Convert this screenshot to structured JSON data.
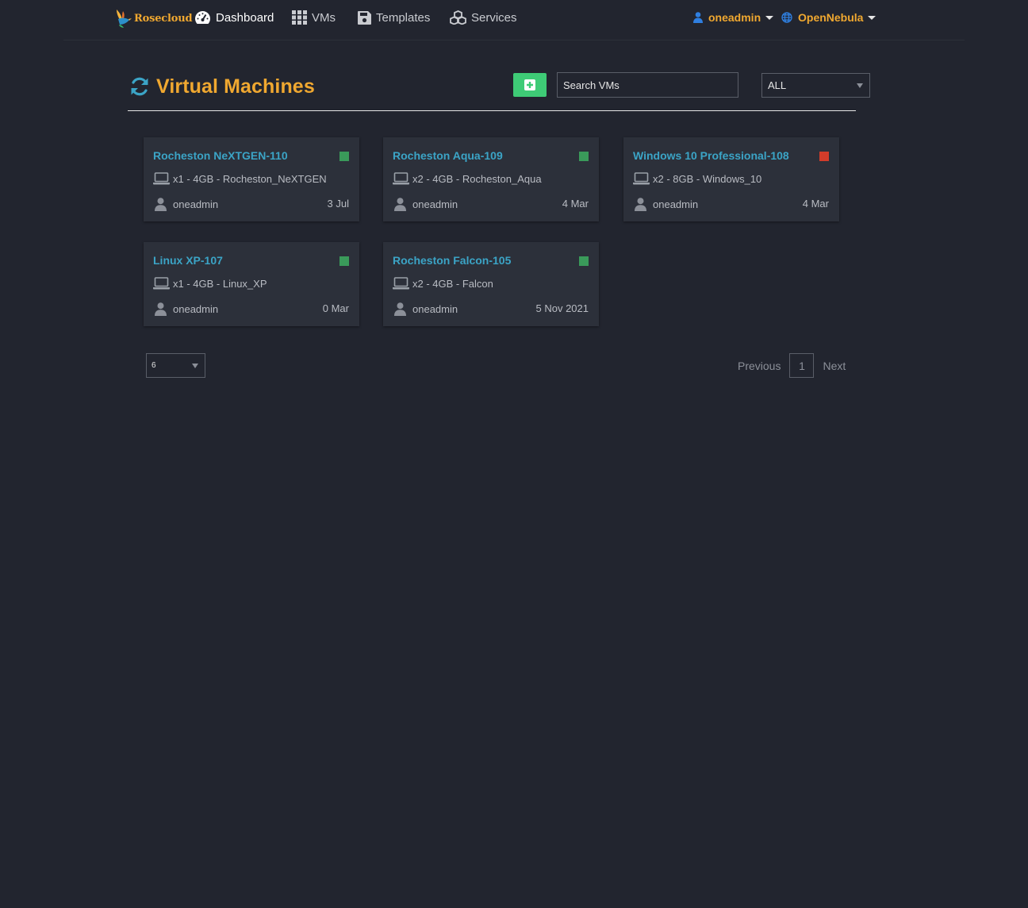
{
  "brand": {
    "name": "Rosecloud",
    "logo_icon": "hummingbird-logo"
  },
  "nav": {
    "items": [
      {
        "label": "Dashboard",
        "icon": "tachometer-icon"
      },
      {
        "label": "VMs",
        "icon": "grid-icon"
      },
      {
        "label": "Templates",
        "icon": "floppy-disk-icon"
      },
      {
        "label": "Services",
        "icon": "cubes-icon"
      }
    ],
    "user": {
      "label": "oneadmin",
      "icon": "user-icon"
    },
    "zone": {
      "label": "OpenNebula",
      "icon": "globe-icon"
    }
  },
  "page": {
    "title": "Virtual Machines",
    "refresh_icon": "refresh-icon",
    "add_icon": "plus-square-icon",
    "search_placeholder": "Search VMs",
    "filter_value": "ALL"
  },
  "colors": {
    "accent": "#f0a830",
    "link": "#3ba4c6",
    "running": "#3a9a5a",
    "stopped": "#d23c2a",
    "add_button": "#3ecb76"
  },
  "vms": [
    {
      "name": "Rocheston NeXTGEN-110",
      "spec": "x1 - 4GB - Rocheston_NeXTGEN",
      "owner": "oneadmin",
      "date": "3 Jul",
      "status": "running"
    },
    {
      "name": "Rocheston Aqua-109",
      "spec": "x2 - 4GB - Rocheston_Aqua",
      "owner": "oneadmin",
      "date": "4 Mar",
      "status": "running"
    },
    {
      "name": "Windows 10 Professional-108",
      "spec": "x2 - 8GB - Windows_10",
      "owner": "oneadmin",
      "date": "4 Mar",
      "status": "stopped"
    },
    {
      "name": "Linux XP-107",
      "spec": "x1 - 4GB - Linux_XP",
      "owner": "oneadmin",
      "date": "0 Mar",
      "status": "running"
    },
    {
      "name": "Rocheston Falcon-105",
      "spec": "x2 - 4GB - Falcon",
      "owner": "oneadmin",
      "date": "5 Nov 2021",
      "status": "running"
    }
  ],
  "footer": {
    "page_size": "6",
    "pagination": {
      "previous": "Previous",
      "current": "1",
      "next": "Next"
    }
  }
}
